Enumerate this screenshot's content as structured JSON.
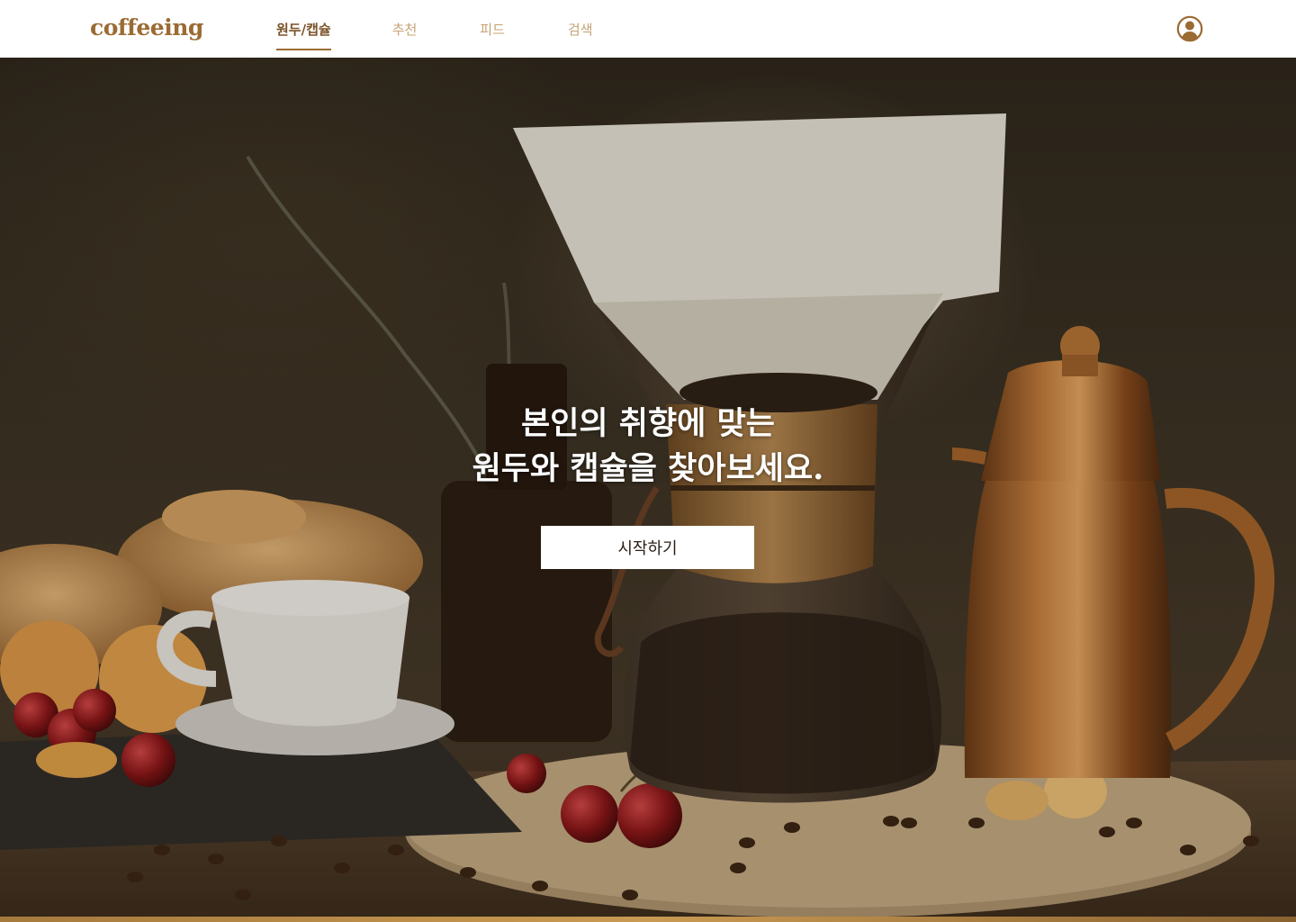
{
  "header": {
    "logo": "coffeeing",
    "nav": [
      {
        "label": "원두/캡슐",
        "active": true
      },
      {
        "label": "추천",
        "active": false
      },
      {
        "label": "피드",
        "active": false
      },
      {
        "label": "검색",
        "active": false
      }
    ],
    "profile_icon": "user-circle-icon"
  },
  "hero": {
    "title_line1": "본인의 취향에 맞는",
    "title_line2": "원두와 캡슐을 찾아보세요.",
    "cta_label": "시작하기"
  },
  "colors": {
    "brand": "#9a6b33",
    "nav_active": "#7a5228",
    "nav_inactive": "#c4a273",
    "button_bg": "#ffffff"
  }
}
